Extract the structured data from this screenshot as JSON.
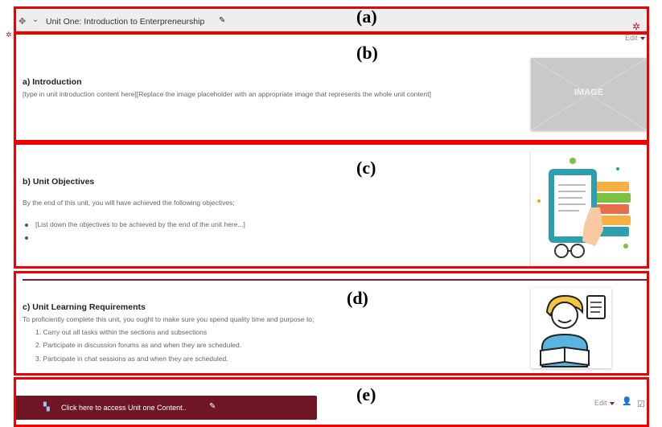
{
  "header": {
    "section_title": "Unit One: Introduction to Enterpreneurship",
    "edit_label": "Edit"
  },
  "panel_labels": [
    "(a)",
    "(b)",
    "(c)",
    "(d)",
    "(e)"
  ],
  "introduction": {
    "heading": "a)  Introduction",
    "body": "[type in unit introduction content here][Replace the image placeholder with an appropriate image that represents the whole unit content]",
    "image_placeholder": "IMAGE"
  },
  "objectives": {
    "heading": "b) Unit Objectives",
    "intro": "By the end of this unit, you will have achieved the following objectives;",
    "items": [
      "[List down the objectives to be achieved by the end of the unit here...]",
      ""
    ]
  },
  "requirements": {
    "heading": "c) Unit Learning Requirements",
    "intro": "To proficiently complete this unit, you ought to make sure you spend quality time and purpose to;",
    "items": [
      "1. Carry out all tasks within the sections and subsections",
      "2. Participate in discussion forums as and when they are scheduled.",
      "3. Participate in chat sessions as and when they are scheduled."
    ]
  },
  "content_link": {
    "label": "Click here to access Unit one Content..",
    "edit_label": "Edit"
  },
  "colors": {
    "frame": "#f20000",
    "accent": "#8b1a2b",
    "button_bg": "#6e1526"
  }
}
